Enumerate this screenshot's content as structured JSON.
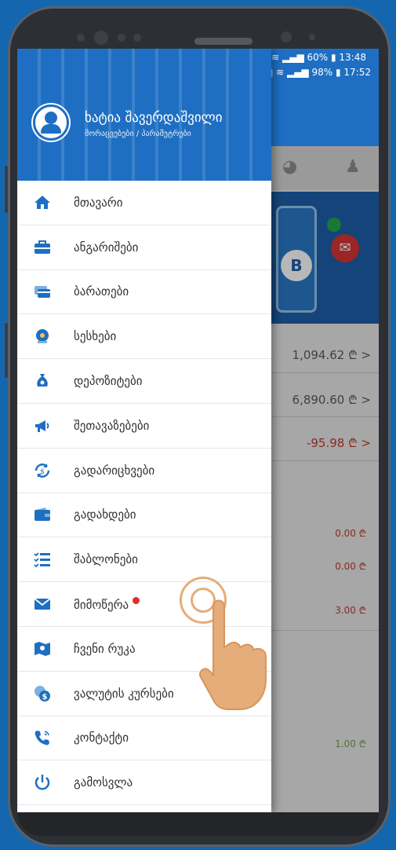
{
  "status_bar": {
    "top": {
      "battery": "60%",
      "time": "13:48"
    },
    "bottom": {
      "battery": "98%",
      "time": "17:52"
    }
  },
  "drawer": {
    "user_name": "ხატია შავერდაშვილი",
    "user_subtitle": "მორაცვებები / პარამეტრები",
    "items": [
      {
        "label": "მთავარი",
        "icon": "home-icon",
        "color": "#1e6fc3"
      },
      {
        "label": "ანგარიშები",
        "icon": "briefcase-icon",
        "color": "#1e6fc3"
      },
      {
        "label": "ბარათები",
        "icon": "cards-icon",
        "color": "#1e6fc3"
      },
      {
        "label": "სესხები",
        "icon": "loan-icon",
        "color": "#1e6fc3"
      },
      {
        "label": "დეპოზიტები",
        "icon": "money-bag-icon",
        "color": "#1e6fc3"
      },
      {
        "label": "შეთავაზებები",
        "icon": "megaphone-icon",
        "color": "#1e6fc3"
      },
      {
        "label": "გადარიცხვები",
        "icon": "transfer-icon",
        "color": "#1e6fc3"
      },
      {
        "label": "გადახდები",
        "icon": "wallet-icon",
        "color": "#1e6fc3"
      },
      {
        "label": "შაბლონები",
        "icon": "checklist-icon",
        "color": "#1e6fc3"
      },
      {
        "label": "მიმოწერა",
        "icon": "envelope-icon",
        "color": "#1e6fc3",
        "badge": true
      },
      {
        "label": "ჩვენი რუკა",
        "icon": "map-icon",
        "color": "#1e6fc3"
      },
      {
        "label": "ვალუტის კურსები",
        "icon": "currency-icon",
        "color": "#1e6fc3"
      },
      {
        "label": "კონტაქტი",
        "icon": "phone-icon",
        "color": "#1e6fc3"
      },
      {
        "label": "გამოსვლა",
        "icon": "power-icon",
        "color": "#1e6fc3"
      }
    ]
  },
  "background": {
    "amounts": [
      "1,094.62 ₾ >",
      "6,890.60 ₾ >",
      "-95.98 ₾ >"
    ],
    "small_amounts": [
      "0.00 ₾",
      "0.00 ₾",
      "3.00 ₾",
      "1.00 ₾"
    ],
    "banner_logo": "B"
  },
  "colors": {
    "primary": "#1e6fc3",
    "background": "#1467ae",
    "badge": "#e22c2c",
    "hand": "#e5ad7a"
  }
}
